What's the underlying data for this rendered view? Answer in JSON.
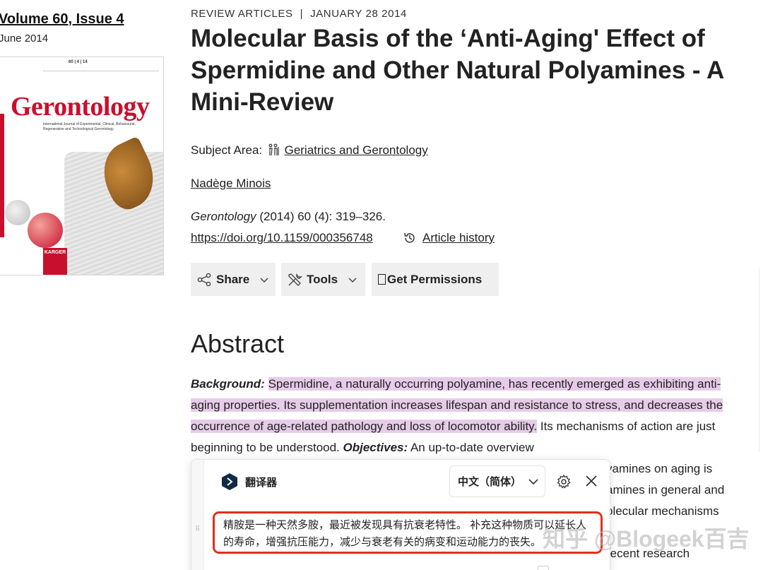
{
  "issue": {
    "title": "Volume 60, Issue 4",
    "date": "June 2014"
  },
  "cover": {
    "journal": "Gerontology",
    "subtitle": "International Journal of Experimental, Clinical, Behavioural, Regenerative and Technological Gerontology",
    "header_numbers": "60 | 4 | 14",
    "publisher": "KARGER"
  },
  "article": {
    "category": "REVIEW ARTICLES",
    "separator": "|",
    "date": "JANUARY 28 2014",
    "title": "Molecular Basis of the ‘Anti-Aging' Effect of Spermidine and Other Natural Polyamines - A Mini-Review",
    "subject_label": "Subject Area:",
    "subject_value": "Geriatrics and Gerontology",
    "author": "Nadège Minois",
    "citation_journal": "Gerontology",
    "citation_rest": " (2014) 60 (4): 319–326.",
    "doi": "https://doi.org/10.1159/000356748",
    "history_label": "Article history"
  },
  "toolbar": {
    "share_label": "Share",
    "tools_label": "Tools",
    "permissions_label": "Get Permissions"
  },
  "abstract": {
    "heading": "Abstract",
    "background_label": "Background:",
    "highlighted_text": "Spermidine, a naturally occurring polyamine, has recently emerged as exhibiting anti-aging properties. Its supplementation increases lifespan and resistance to stress, and decreases the occurrence of age-related pathology and loss of locomotor ability.",
    "after_highlight": " Its mechanisms of action are just beginning to be understood. ",
    "objectives_label": "Objectives:",
    "objectives_start": " An up-to-date overview",
    "fragment_1": "yamines on aging is",
    "fragment_2": "amines in general and",
    "fragment_3": "olecular mechanisms",
    "fragment_4": "recent research"
  },
  "translator": {
    "name": "翻译器",
    "language": "中文（简体）",
    "output": "精胺是一种天然多胺，最近被发现具有抗衰老特性。 补充这种物质可以延长人的寿命，增强抗压能力，减少与衰老有关的病变和运动能力的丧失。"
  },
  "watermark": "知乎 @Blogeek百吉",
  "colors": {
    "highlight": "#e6cce8",
    "translator_border": "#e0301e",
    "button_bg": "#efefef",
    "cover_red": "#c8102e"
  }
}
